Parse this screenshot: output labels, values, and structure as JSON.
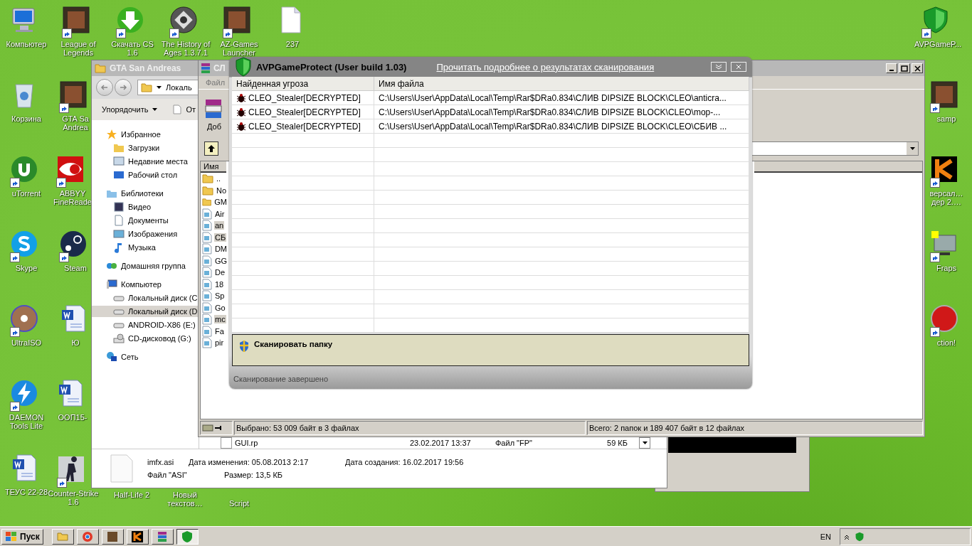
{
  "desktop_icons": [
    {
      "label": "Компьютер",
      "kind": "computer",
      "shortcut": false
    },
    {
      "label": "League of Legends",
      "kind": "picture",
      "shortcut": true
    },
    {
      "label": "Скачать CS 1.6",
      "kind": "download",
      "shortcut": true
    },
    {
      "label": "The History of Ages 1.3.7.1",
      "kind": "emblem",
      "shortcut": true
    },
    {
      "label": "AZ-Games Launcher",
      "kind": "picture",
      "shortcut": true
    },
    {
      "label": "237",
      "kind": "file",
      "shortcut": false
    },
    {
      "label": "AVPGameP...",
      "kind": "shield",
      "shortcut": true
    },
    {
      "label": "Корзина",
      "kind": "trash",
      "shortcut": false
    },
    {
      "label": "GTA Sa Andrea",
      "kind": "picture",
      "shortcut": true
    },
    {
      "label": "samp",
      "kind": "picture",
      "shortcut": true
    },
    {
      "label": "uTorrent",
      "kind": "torrent",
      "shortcut": true
    },
    {
      "label": "ABBYY FineReade",
      "kind": "eye",
      "shortcut": true
    },
    {
      "label": "версал… дер 2.…",
      "kind": "letter",
      "shortcut": true
    },
    {
      "label": "Skype",
      "kind": "skype",
      "shortcut": true
    },
    {
      "label": "Steam",
      "kind": "steam",
      "shortcut": true
    },
    {
      "label": "Fraps",
      "kind": "monitor",
      "shortcut": true
    },
    {
      "label": "UltraISO",
      "kind": "disc",
      "shortcut": true
    },
    {
      "label": "Ю",
      "kind": "word",
      "shortcut": false
    },
    {
      "label": "ction!",
      "kind": "record",
      "shortcut": true
    },
    {
      "label": "DAEMON Tools Lite",
      "kind": "bolt",
      "shortcut": true
    },
    {
      "label": "ООП15-",
      "kind": "word",
      "shortcut": false
    },
    {
      "label": "ТЕУС 22-28",
      "kind": "word",
      "shortcut": false
    },
    {
      "label": "Counter-Strike 1.6",
      "kind": "soldier",
      "shortcut": true
    },
    {
      "label": "Half-Life 2"
    },
    {
      "label": "Новый текстов…"
    },
    {
      "label": "Script"
    }
  ],
  "explorer": {
    "title": "GTA San Andreas",
    "address": "Локаль",
    "organize": "Упорядочить",
    "open": "От",
    "nav": [
      {
        "label": "Избранное",
        "kind": "star",
        "selected": false,
        "children": [
          {
            "label": "Загрузки",
            "kind": "folder",
            "selected": false
          },
          {
            "label": "Недавние места",
            "kind": "recent",
            "selected": false
          },
          {
            "label": "Рабочий стол",
            "kind": "desktop",
            "selected": false
          }
        ]
      },
      {
        "label": "Библиотеки",
        "kind": "library",
        "selected": false,
        "children": [
          {
            "label": "Видео",
            "kind": "video",
            "selected": false
          },
          {
            "label": "Документы",
            "kind": "doc",
            "selected": false
          },
          {
            "label": "Изображения",
            "kind": "image",
            "selected": false
          },
          {
            "label": "Музыка",
            "kind": "music",
            "selected": false
          }
        ]
      },
      {
        "label": "Домашняя группа",
        "kind": "group",
        "selected": false
      },
      {
        "label": "Компьютер",
        "kind": "computer",
        "selected": false,
        "children": [
          {
            "label": "Локальный диск (C",
            "kind": "drive",
            "selected": false
          },
          {
            "label": "Локальный диск (D",
            "kind": "drive",
            "selected": true
          },
          {
            "label": "ANDROID-X86 (E:)",
            "kind": "drive",
            "selected": false
          },
          {
            "label": "CD-дисковод (G:)",
            "kind": "cd",
            "selected": false
          }
        ]
      },
      {
        "label": "Сеть",
        "kind": "network",
        "selected": false
      }
    ],
    "file_row": {
      "name": "GUI.rp",
      "date": "23.02.2017 13:37",
      "type": "Файл \"FP\"",
      "size": "59 КБ"
    },
    "details": {
      "name": "imfx.asi",
      "type": "Файл \"ASI\"",
      "modified": "Дата изменения: 05.08.2013 2:17",
      "created": "Дата создания: 16.02.2017 19:56",
      "size": "Размер: 13,5 КБ"
    }
  },
  "archiver": {
    "title": "СЛ",
    "menu": "Файл",
    "add": "Доб",
    "column": "Имя",
    "files": [
      {
        "name": "..",
        "kind": "folder",
        "selected": false
      },
      {
        "name": "No",
        "kind": "folder",
        "selected": false
      },
      {
        "name": "GM",
        "kind": "folder",
        "selected": false
      },
      {
        "name": "Air",
        "kind": "file",
        "selected": false
      },
      {
        "name": "an",
        "kind": "file",
        "selected": true
      },
      {
        "name": "СБ",
        "kind": "file",
        "selected": true
      },
      {
        "name": "DM",
        "kind": "file",
        "selected": false
      },
      {
        "name": "GG",
        "kind": "file",
        "selected": false
      },
      {
        "name": "De",
        "kind": "file",
        "selected": false
      },
      {
        "name": "18",
        "kind": "file",
        "selected": false
      },
      {
        "name": "Sp",
        "kind": "file",
        "selected": false
      },
      {
        "name": "Go",
        "kind": "file",
        "selected": false
      },
      {
        "name": "mc",
        "kind": "file",
        "selected": true
      },
      {
        "name": "Fa",
        "kind": "file",
        "selected": false
      },
      {
        "name": "pir",
        "kind": "file",
        "selected": false
      }
    ],
    "status_left": "Выбрано: 53 009 байт в 3 файлах",
    "status_right": "Всего: 2 папок и 189 407 байт в 12 файлах"
  },
  "scanner": {
    "title": "AVPGameProtect (User build 1.03)",
    "link": "Прочитать подробнее о результатах сканирования",
    "columns": [
      "Найденная угроза",
      "Имя файла"
    ],
    "threats": [
      {
        "name": "CLEO_Stealer[DECRYPTED]",
        "path": "C:\\Users\\User\\AppData\\Local\\Temp\\Rar$DRa0.834\\СЛИВ DIPSIZE BLOCK\\CLEO\\anticra..."
      },
      {
        "name": "CLEO_Stealer[DECRYPTED]",
        "path": "C:\\Users\\User\\AppData\\Local\\Temp\\Rar$DRa0.834\\СЛИВ DIPSIZE BLOCK\\CLEO\\mop-..."
      },
      {
        "name": "CLEO_Stealer[DECRYPTED]",
        "path": "C:\\Users\\User\\AppData\\Local\\Temp\\Rar$DRa0.834\\СЛИВ DIPSIZE BLOCK\\CLEO\\СБИВ ..."
      }
    ],
    "scan_button": "Сканировать папку",
    "status": "Сканирование завершено"
  },
  "taskbar": {
    "start": "Пуск",
    "apps": [
      {
        "kind": "explorer",
        "selected": false
      },
      {
        "kind": "browser",
        "selected": false
      },
      {
        "kind": "picture",
        "selected": false
      },
      {
        "kind": "letter",
        "selected": false
      },
      {
        "kind": "archive",
        "selected": false
      },
      {
        "kind": "shield",
        "selected": true
      }
    ],
    "language": "EN"
  }
}
